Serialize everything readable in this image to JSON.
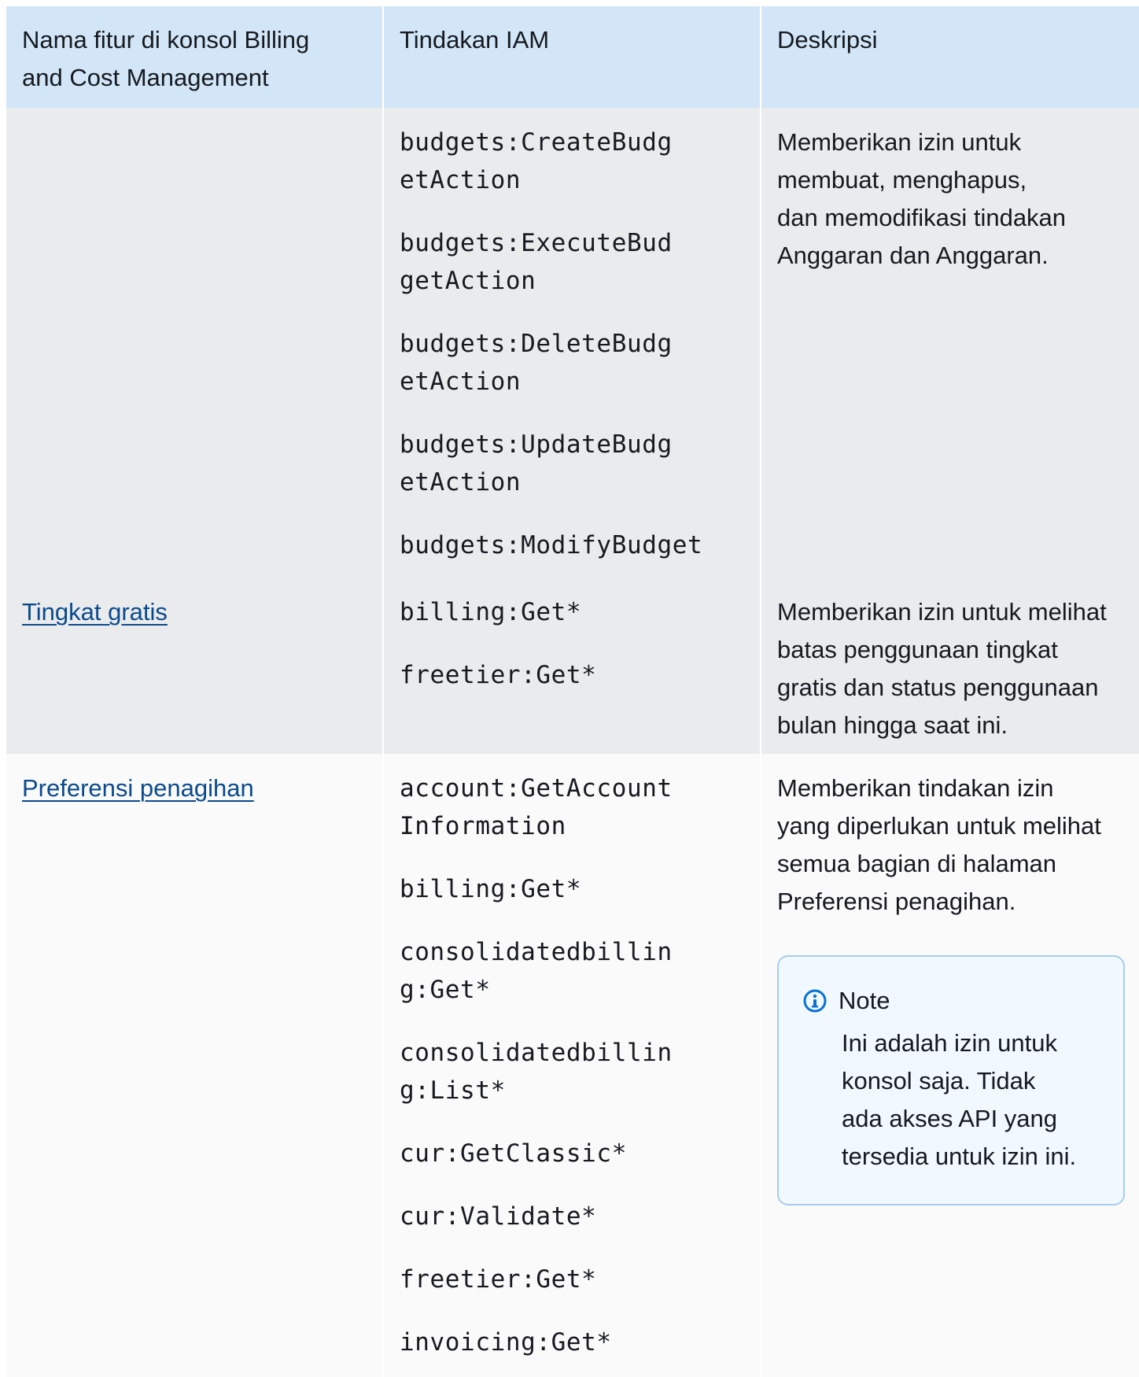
{
  "table": {
    "headers": [
      "Nama fitur di konsol Billing\nand Cost Management",
      "Tindakan IAM",
      "Deskripsi"
    ],
    "rows": [
      {
        "feature": "",
        "actions": [
          "budgets:CreateBudg\netAction",
          "budgets:ExecuteBud\ngetAction",
          "budgets:DeleteBudg\netAction",
          "budgets:UpdateBudg\netAction",
          "budgets:ModifyBudget"
        ],
        "description": "Memberikan izin untuk\nmembuat, menghapus,\ndan memodifikasi tindakan\nAnggaran dan Anggaran."
      },
      {
        "feature": "Tingkat gratis",
        "actions": [
          "billing:Get*",
          "freetier:Get*"
        ],
        "description": "Memberikan izin untuk melihat\nbatas penggunaan tingkat\ngratis dan status penggunaan\nbulan hingga saat ini."
      },
      {
        "feature": "Preferensi penagihan",
        "actions": [
          "account:GetAccount\nInformation",
          "billing:Get*",
          "consolidatedbillin\ng:Get*",
          "consolidatedbillin\ng:List*",
          "cur:GetClassic*",
          "cur:Validate*",
          "freetier:Get*",
          "invoicing:Get*"
        ],
        "description": "Memberikan tindakan izin\nyang diperlukan untuk melihat\nsemua bagian di halaman\nPreferensi penagihan.",
        "note": {
          "title": "Note",
          "icon": "info-icon",
          "text": "Ini adalah izin untuk\nkonsol saja. Tidak\nada akses API yang\ntersedia untuk izin ini."
        }
      }
    ]
  },
  "colors": {
    "header_bg": "#d2e6f8",
    "row_shaded": "#eaebed",
    "row_light": "#fafafa",
    "link": "#0a4a8c",
    "note_border": "#a7cdf0",
    "note_bg": "#f1f8ff"
  }
}
